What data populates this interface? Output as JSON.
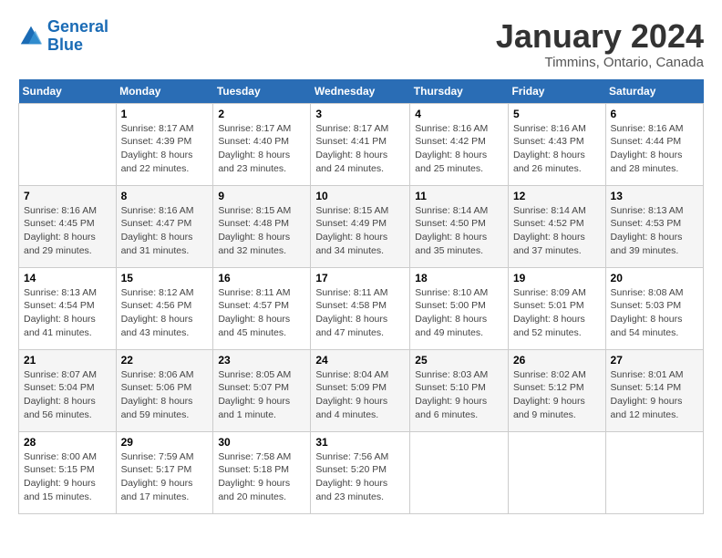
{
  "logo": {
    "line1": "General",
    "line2": "Blue"
  },
  "title": "January 2024",
  "subtitle": "Timmins, Ontario, Canada",
  "weekdays": [
    "Sunday",
    "Monday",
    "Tuesday",
    "Wednesday",
    "Thursday",
    "Friday",
    "Saturday"
  ],
  "weeks": [
    [
      {
        "day": "",
        "info": ""
      },
      {
        "day": "1",
        "info": "Sunrise: 8:17 AM\nSunset: 4:39 PM\nDaylight: 8 hours\nand 22 minutes."
      },
      {
        "day": "2",
        "info": "Sunrise: 8:17 AM\nSunset: 4:40 PM\nDaylight: 8 hours\nand 23 minutes."
      },
      {
        "day": "3",
        "info": "Sunrise: 8:17 AM\nSunset: 4:41 PM\nDaylight: 8 hours\nand 24 minutes."
      },
      {
        "day": "4",
        "info": "Sunrise: 8:16 AM\nSunset: 4:42 PM\nDaylight: 8 hours\nand 25 minutes."
      },
      {
        "day": "5",
        "info": "Sunrise: 8:16 AM\nSunset: 4:43 PM\nDaylight: 8 hours\nand 26 minutes."
      },
      {
        "day": "6",
        "info": "Sunrise: 8:16 AM\nSunset: 4:44 PM\nDaylight: 8 hours\nand 28 minutes."
      }
    ],
    [
      {
        "day": "7",
        "info": "Sunrise: 8:16 AM\nSunset: 4:45 PM\nDaylight: 8 hours\nand 29 minutes."
      },
      {
        "day": "8",
        "info": "Sunrise: 8:16 AM\nSunset: 4:47 PM\nDaylight: 8 hours\nand 31 minutes."
      },
      {
        "day": "9",
        "info": "Sunrise: 8:15 AM\nSunset: 4:48 PM\nDaylight: 8 hours\nand 32 minutes."
      },
      {
        "day": "10",
        "info": "Sunrise: 8:15 AM\nSunset: 4:49 PM\nDaylight: 8 hours\nand 34 minutes."
      },
      {
        "day": "11",
        "info": "Sunrise: 8:14 AM\nSunset: 4:50 PM\nDaylight: 8 hours\nand 35 minutes."
      },
      {
        "day": "12",
        "info": "Sunrise: 8:14 AM\nSunset: 4:52 PM\nDaylight: 8 hours\nand 37 minutes."
      },
      {
        "day": "13",
        "info": "Sunrise: 8:13 AM\nSunset: 4:53 PM\nDaylight: 8 hours\nand 39 minutes."
      }
    ],
    [
      {
        "day": "14",
        "info": "Sunrise: 8:13 AM\nSunset: 4:54 PM\nDaylight: 8 hours\nand 41 minutes."
      },
      {
        "day": "15",
        "info": "Sunrise: 8:12 AM\nSunset: 4:56 PM\nDaylight: 8 hours\nand 43 minutes."
      },
      {
        "day": "16",
        "info": "Sunrise: 8:11 AM\nSunset: 4:57 PM\nDaylight: 8 hours\nand 45 minutes."
      },
      {
        "day": "17",
        "info": "Sunrise: 8:11 AM\nSunset: 4:58 PM\nDaylight: 8 hours\nand 47 minutes."
      },
      {
        "day": "18",
        "info": "Sunrise: 8:10 AM\nSunset: 5:00 PM\nDaylight: 8 hours\nand 49 minutes."
      },
      {
        "day": "19",
        "info": "Sunrise: 8:09 AM\nSunset: 5:01 PM\nDaylight: 8 hours\nand 52 minutes."
      },
      {
        "day": "20",
        "info": "Sunrise: 8:08 AM\nSunset: 5:03 PM\nDaylight: 8 hours\nand 54 minutes."
      }
    ],
    [
      {
        "day": "21",
        "info": "Sunrise: 8:07 AM\nSunset: 5:04 PM\nDaylight: 8 hours\nand 56 minutes."
      },
      {
        "day": "22",
        "info": "Sunrise: 8:06 AM\nSunset: 5:06 PM\nDaylight: 8 hours\nand 59 minutes."
      },
      {
        "day": "23",
        "info": "Sunrise: 8:05 AM\nSunset: 5:07 PM\nDaylight: 9 hours\nand 1 minute."
      },
      {
        "day": "24",
        "info": "Sunrise: 8:04 AM\nSunset: 5:09 PM\nDaylight: 9 hours\nand 4 minutes."
      },
      {
        "day": "25",
        "info": "Sunrise: 8:03 AM\nSunset: 5:10 PM\nDaylight: 9 hours\nand 6 minutes."
      },
      {
        "day": "26",
        "info": "Sunrise: 8:02 AM\nSunset: 5:12 PM\nDaylight: 9 hours\nand 9 minutes."
      },
      {
        "day": "27",
        "info": "Sunrise: 8:01 AM\nSunset: 5:14 PM\nDaylight: 9 hours\nand 12 minutes."
      }
    ],
    [
      {
        "day": "28",
        "info": "Sunrise: 8:00 AM\nSunset: 5:15 PM\nDaylight: 9 hours\nand 15 minutes."
      },
      {
        "day": "29",
        "info": "Sunrise: 7:59 AM\nSunset: 5:17 PM\nDaylight: 9 hours\nand 17 minutes."
      },
      {
        "day": "30",
        "info": "Sunrise: 7:58 AM\nSunset: 5:18 PM\nDaylight: 9 hours\nand 20 minutes."
      },
      {
        "day": "31",
        "info": "Sunrise: 7:56 AM\nSunset: 5:20 PM\nDaylight: 9 hours\nand 23 minutes."
      },
      {
        "day": "",
        "info": ""
      },
      {
        "day": "",
        "info": ""
      },
      {
        "day": "",
        "info": ""
      }
    ]
  ]
}
